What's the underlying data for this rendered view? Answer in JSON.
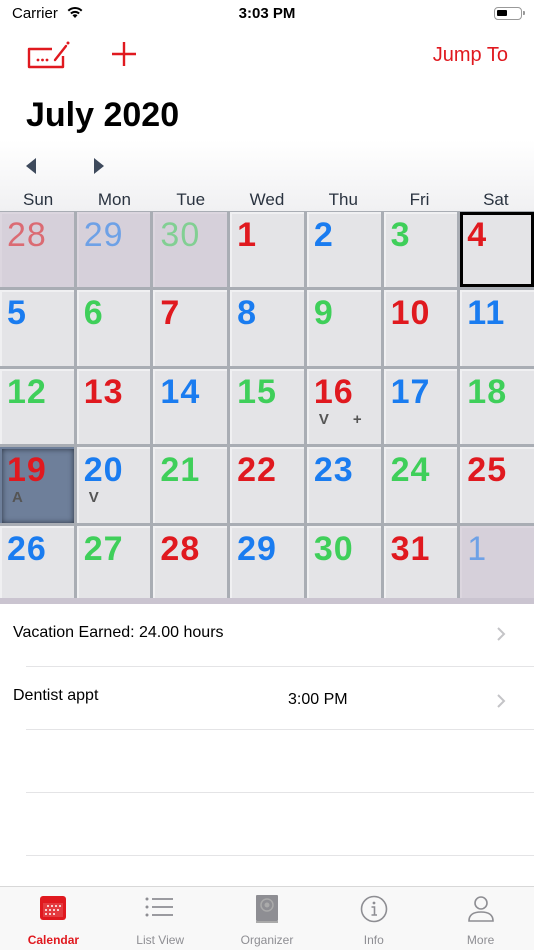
{
  "status_bar": {
    "carrier": "Carrier",
    "time": "3:03 PM"
  },
  "toolbar": {
    "edit_icon": "keyboard-edit-icon",
    "add_icon": "plus-icon",
    "jump_to_label": "Jump To"
  },
  "month_title": "July 2020",
  "nav": {
    "prev_icon": "triangle-left-icon",
    "next_icon": "triangle-right-icon"
  },
  "weekdays": [
    "Sun",
    "Mon",
    "Tue",
    "Wed",
    "Thu",
    "Fri",
    "Sat"
  ],
  "colors": {
    "red": "#e0191f",
    "blue": "#1a7cf0",
    "green": "#3fcf5a",
    "accent": "#e0191f"
  },
  "weeks": [
    [
      {
        "day": "28",
        "color": "red",
        "other": true
      },
      {
        "day": "29",
        "color": "blue",
        "other": true
      },
      {
        "day": "30",
        "color": "green",
        "other": true
      },
      {
        "day": "1",
        "color": "red"
      },
      {
        "day": "2",
        "color": "blue"
      },
      {
        "day": "3",
        "color": "green"
      },
      {
        "day": "4",
        "color": "red",
        "today": true
      }
    ],
    [
      {
        "day": "5",
        "color": "blue"
      },
      {
        "day": "6",
        "color": "green"
      },
      {
        "day": "7",
        "color": "red"
      },
      {
        "day": "8",
        "color": "blue"
      },
      {
        "day": "9",
        "color": "green"
      },
      {
        "day": "10",
        "color": "red"
      },
      {
        "day": "11",
        "color": "blue"
      }
    ],
    [
      {
        "day": "12",
        "color": "green"
      },
      {
        "day": "13",
        "color": "red"
      },
      {
        "day": "14",
        "color": "blue"
      },
      {
        "day": "15",
        "color": "green"
      },
      {
        "day": "16",
        "color": "red",
        "marks": [
          "V",
          "+"
        ]
      },
      {
        "day": "17",
        "color": "blue"
      },
      {
        "day": "18",
        "color": "green"
      }
    ],
    [
      {
        "day": "19",
        "color": "red",
        "selected": true,
        "marks": [
          "A"
        ]
      },
      {
        "day": "20",
        "color": "blue",
        "marks": [
          "V"
        ]
      },
      {
        "day": "21",
        "color": "green"
      },
      {
        "day": "22",
        "color": "red"
      },
      {
        "day": "23",
        "color": "blue"
      },
      {
        "day": "24",
        "color": "green"
      },
      {
        "day": "25",
        "color": "red"
      }
    ],
    [
      {
        "day": "26",
        "color": "blue"
      },
      {
        "day": "27",
        "color": "green"
      },
      {
        "day": "28",
        "color": "red"
      },
      {
        "day": "29",
        "color": "blue"
      },
      {
        "day": "30",
        "color": "green"
      },
      {
        "day": "31",
        "color": "red"
      },
      {
        "day": "1",
        "color": "blue",
        "other": true
      }
    ]
  ],
  "events": [
    {
      "title": "Vacation Earned: 24.00 hours",
      "time": ""
    },
    {
      "title": "Dentist appt",
      "time": "3:00 PM"
    }
  ],
  "tabs": [
    {
      "label": "Calendar",
      "icon": "calendar-icon",
      "active": true
    },
    {
      "label": "List View",
      "icon": "list-icon"
    },
    {
      "label": "Organizer",
      "icon": "organizer-book-icon"
    },
    {
      "label": "Info",
      "icon": "info-icon"
    },
    {
      "label": "More",
      "icon": "person-icon"
    }
  ]
}
